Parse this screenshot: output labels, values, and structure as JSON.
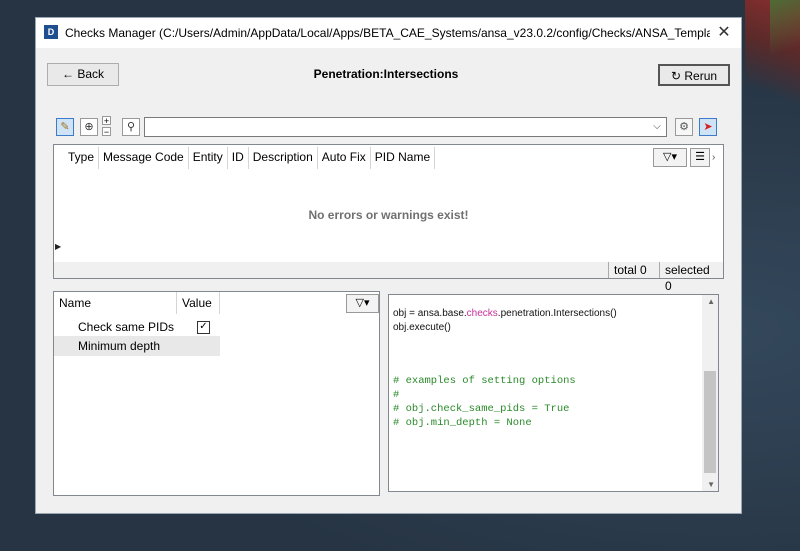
{
  "window": {
    "title": "Checks Manager (C:/Users/Admin/AppData/Local/Apps/BETA_CAE_Systems/ansa_v23.0.2/config/Checks/ANSA_Templates...",
    "app_icon": "ansa-app-icon",
    "close_glyph": "✕"
  },
  "header": {
    "back_label": "Back",
    "back_icon": "←",
    "page_title": "Penetration:Intersections",
    "rerun_label": "Rerun",
    "rerun_icon": "↻"
  },
  "toolbar": {
    "search_value": "",
    "icons": [
      "pick-icon",
      "zoom-icon",
      "plus-icon",
      "minus-icon",
      "search-icon",
      "gear-icon",
      "cursor-icon"
    ]
  },
  "results": {
    "columns": [
      "Type",
      "Message Code",
      "Entity",
      "ID",
      "Description",
      "Auto Fix",
      "PID Name"
    ],
    "empty_message": "No errors or warnings exist!",
    "total": "total 0",
    "selected": "selected 0"
  },
  "options": {
    "columns": [
      "Name",
      "Value"
    ],
    "rows": [
      {
        "label": "Check same PIDs",
        "checked": true
      },
      {
        "label": "Minimum depth",
        "value": ""
      }
    ]
  },
  "code": {
    "line1_prefix": "obj = ansa.base.",
    "line1_keyword": "checks",
    "line1_suffix": ".penetration.Intersections()",
    "line2": "obj.execute()",
    "comments": [
      "# examples of setting options",
      "#",
      "# obj.check_same_pids = True",
      "# obj.min_depth = None"
    ]
  },
  "colors": {
    "window_bg": "#f0f0f0",
    "desktop_bg": "#263443",
    "comment_green": "#2b8a2b",
    "keyword_magenta": "#c8309a",
    "selection_blue": "#cfe3f7"
  }
}
